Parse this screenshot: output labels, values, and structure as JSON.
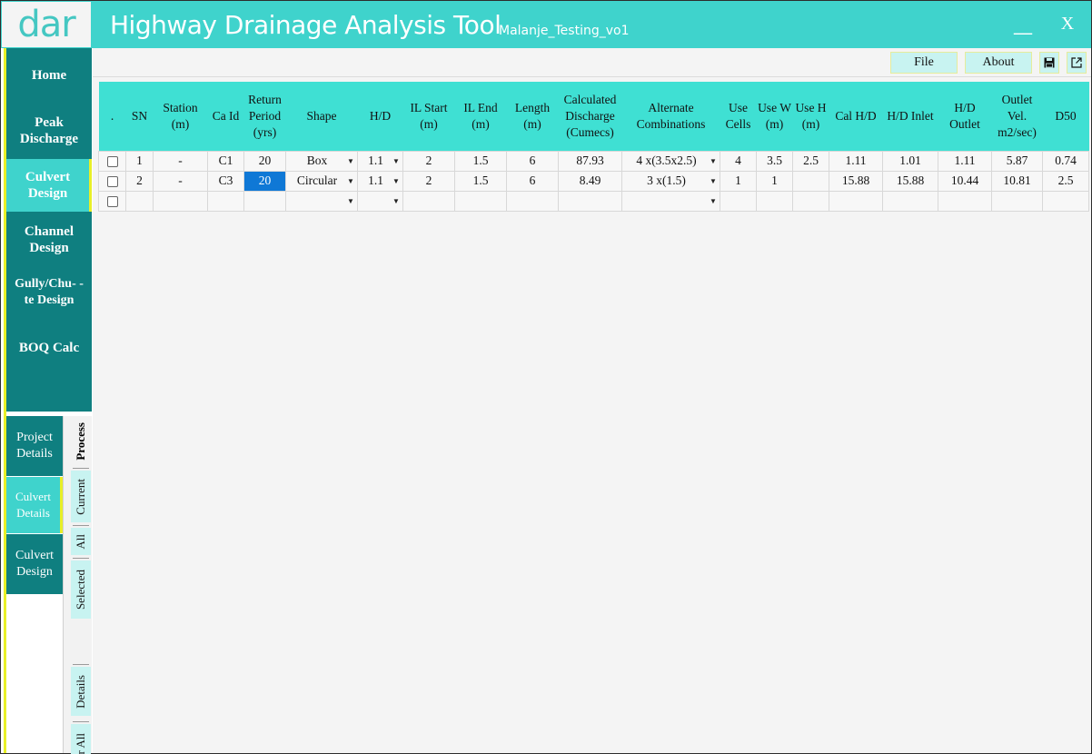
{
  "window": {
    "logo": "dar",
    "title": "Highway Drainage Analysis Tool",
    "project": "Malanje_Testing_vo1",
    "minimize": "__",
    "close": "X"
  },
  "colors": {
    "accent": "#3fd3cc",
    "nav_dark": "#0f7f80",
    "highlight": "#e8ef27",
    "header_bg": "#3fe0d3",
    "selected_cell": "#0f78d6"
  },
  "main_nav": [
    {
      "label": "Home"
    },
    {
      "label": "Peak Discharge"
    },
    {
      "label": "Culvert Design",
      "active": true
    },
    {
      "label": "Channel Design"
    },
    {
      "label": "Gully/Chu- -te Design"
    },
    {
      "label": "BOQ Calc"
    }
  ],
  "sub_nav": [
    {
      "label": "Project Details"
    },
    {
      "label": "Culvert Details",
      "active": true
    },
    {
      "label": "Culvert Design"
    }
  ],
  "vertical_tabs": [
    "Process",
    "Current",
    "All",
    "Selected",
    "Details",
    "Clear All"
  ],
  "toolbar": {
    "file": "File",
    "about": "About",
    "save_icon": "floppy-disk-icon",
    "popout_icon": "external-link-icon"
  },
  "table": {
    "headers": [
      ".",
      "SN",
      "Station (m)",
      "Ca Id",
      "Return Period (yrs)",
      "Shape",
      "H/D",
      "IL Start (m)",
      "IL End (m)",
      "Length (m)",
      "Calculated Discharge (Cumecs)",
      "Alternate Combinations",
      "Use Cells",
      "Use W (m)",
      "Use H (m)",
      "Cal H/D",
      "H/D Inlet",
      "H/D Outlet",
      "Outlet Vel. m2/sec)",
      "D50"
    ],
    "rows": [
      {
        "sn": "1",
        "station": "-",
        "ca_id": "C1",
        "return_period": "20",
        "shape": "Box",
        "hd": "1.1",
        "il_start": "2",
        "il_end": "1.5",
        "length": "6",
        "discharge": "87.93",
        "alt": "4 x(3.5x2.5)",
        "use_cells": "4",
        "use_w": "3.5",
        "use_h": "2.5",
        "cal_hd": "1.11",
        "hd_inlet": "1.01",
        "hd_outlet": "1.11",
        "outlet_vel": "5.87",
        "d50": "0.74"
      },
      {
        "sn": "2",
        "station": "-",
        "ca_id": "C3",
        "return_period": "20",
        "shape": "Circular",
        "hd": "1.1",
        "il_start": "2",
        "il_end": "1.5",
        "length": "6",
        "discharge": "8.49",
        "alt": "3 x(1.5)",
        "use_cells": "1",
        "use_w": "1",
        "use_h": "",
        "cal_hd": "15.88",
        "hd_inlet": "15.88",
        "hd_outlet": "10.44",
        "outlet_vel": "10.81",
        "d50": "2.5"
      },
      {
        "sn": "",
        "station": "",
        "ca_id": "",
        "return_period": "",
        "shape": "",
        "hd": "",
        "il_start": "",
        "il_end": "",
        "length": "",
        "discharge": "",
        "alt": "",
        "use_cells": "",
        "use_w": "",
        "use_h": "",
        "cal_hd": "",
        "hd_inlet": "",
        "hd_outlet": "",
        "outlet_vel": "",
        "d50": ""
      }
    ]
  }
}
